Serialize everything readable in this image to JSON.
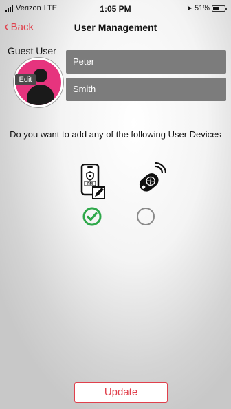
{
  "status_bar": {
    "carrier": "Verizon",
    "network": "LTE",
    "time": "1:05 PM",
    "battery_percent": "51%",
    "battery_level": 0.51
  },
  "nav": {
    "back_label": "Back",
    "title": "User Management"
  },
  "user": {
    "section_label": "Guest User",
    "edit_label": "Edit",
    "first_name": "Peter",
    "last_name": "Smith"
  },
  "devices": {
    "prompt": "Do you want to add any of the following User Devices",
    "items": [
      {
        "icon": "smartphone-app-icon",
        "selected": true
      },
      {
        "icon": "key-fob-icon",
        "selected": false
      }
    ]
  },
  "actions": {
    "update_label": "Update"
  },
  "colors": {
    "accent": "#e0404c",
    "avatar": "#e6347e",
    "check": "#2ea84a",
    "field_bg": "#7c7c7c"
  }
}
